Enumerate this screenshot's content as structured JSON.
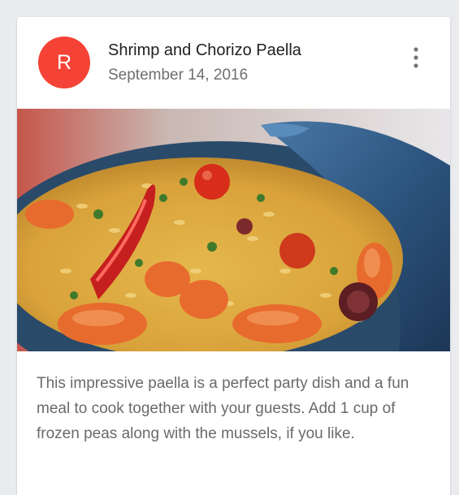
{
  "card": {
    "avatar": {
      "letter": "R",
      "color": "#f44336"
    },
    "title": "Shrimp and Chorizo Paella",
    "subheader": "September 14, 2016",
    "menu_icon": "more-vert-icon",
    "media": {
      "icon": "paella-dish-photo"
    },
    "body": "This impressive paella is a perfect party dish and a fun meal to cook together with your guests. Add 1 cup of frozen peas along with the mussels, if you like."
  }
}
